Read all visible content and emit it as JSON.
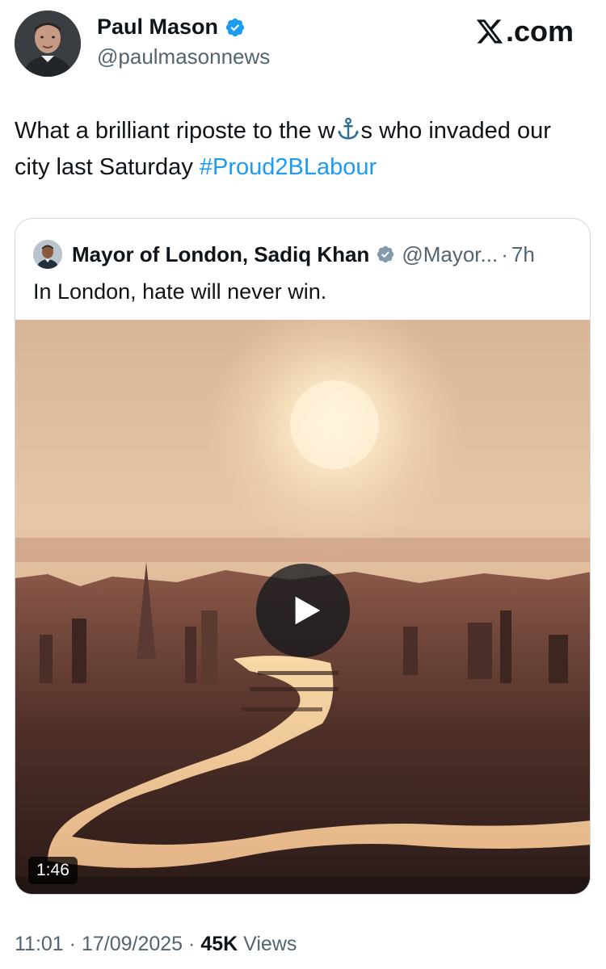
{
  "author": {
    "name": "Paul Mason",
    "handle": "@paulmasonnews",
    "verified": true,
    "avatar_icon": "profile-photo"
  },
  "brand": {
    "logo_icon": "x-logo-icon",
    "site_text": ".com"
  },
  "tweet": {
    "text_before_emoji": "What a brilliant riposte to the w",
    "emoji_icon": "anchor-icon",
    "text_after_emoji": "s who invaded our city last Saturday ",
    "hashtag": "#Proud2BLabour"
  },
  "quote": {
    "name": "Mayor of London, Sadiq Khan",
    "verified_badge": "grey-verified-icon",
    "handle": "@Mayor...",
    "separator": "·",
    "time": "7h",
    "text": "In London, hate will never win.",
    "media": {
      "type": "video",
      "duration": "1:46",
      "play_icon": "play-icon"
    }
  },
  "meta": {
    "time": "11:01",
    "separator": "·",
    "date": "17/09/2025",
    "views_count": "45K",
    "views_label": "Views"
  },
  "colors": {
    "accent": "#1d9bf0",
    "text": "#0f1419",
    "secondary": "#536471",
    "border": "#cfd9de"
  }
}
